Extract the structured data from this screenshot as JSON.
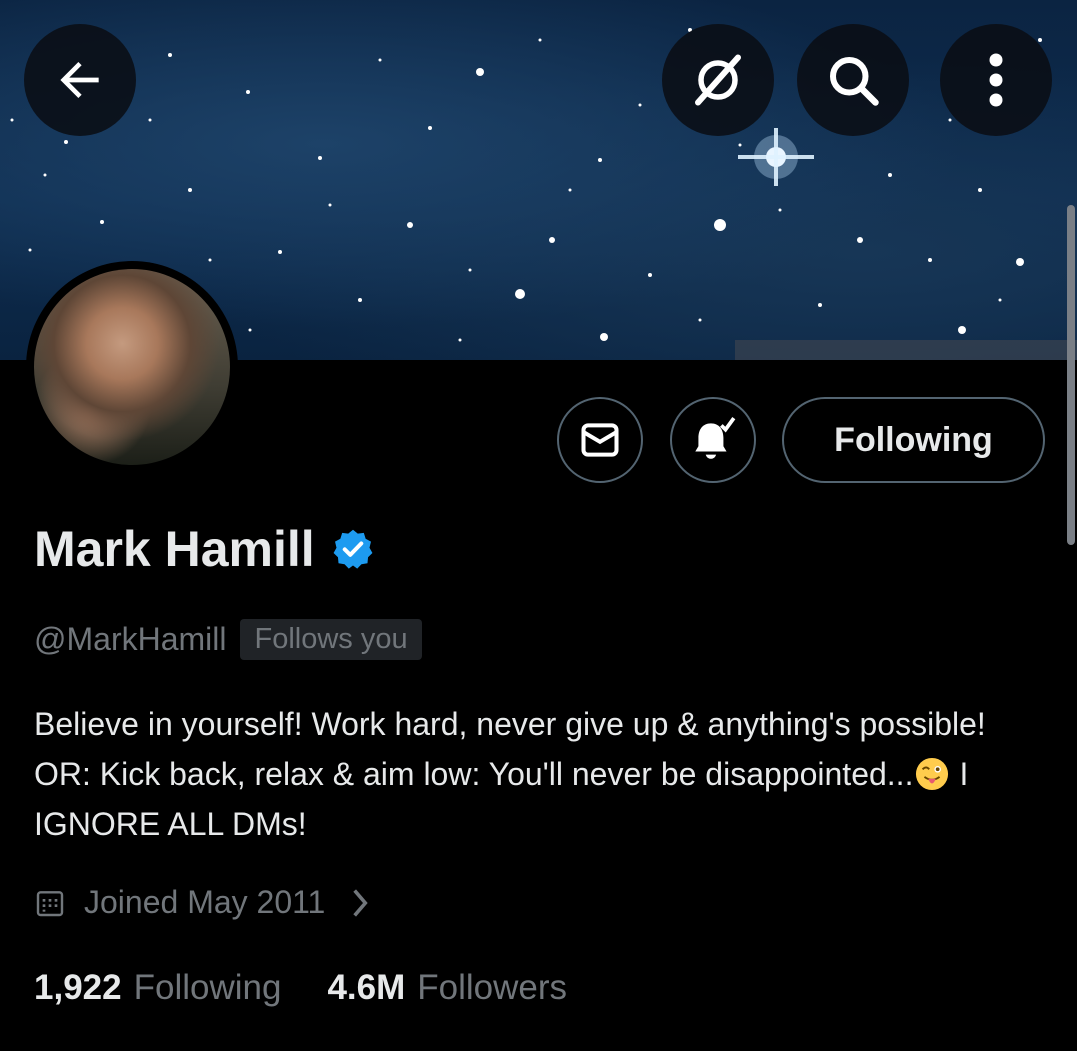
{
  "header": {
    "back_icon": "arrow-left-icon",
    "grok_icon": "grok-slash-icon",
    "search_icon": "search-icon",
    "more_icon": "more-vertical-icon"
  },
  "profile": {
    "display_name": "Mark Hamill",
    "verified": true,
    "handle": "@MarkHamill",
    "follows_you_label": "Follows you",
    "bio_part1": "Believe in yourself! Work hard, never give up & anything's possible! OR: Kick back, relax & aim low: You'll never be disappointed...",
    "bio_emoji": "winking-face-with-tongue",
    "bio_part2": "I IGNORE ALL DMs!",
    "joined": "Joined May 2011"
  },
  "actions": {
    "message_icon": "envelope-icon",
    "notify_icon": "bell-check-icon",
    "follow_label": "Following"
  },
  "stats": {
    "following_count": "1,922",
    "following_label": "Following",
    "followers_count": "4.6M",
    "followers_label": "Followers"
  },
  "colors": {
    "background": "#000000",
    "verified_blue": "#1d9bf0",
    "muted_text": "#71767b",
    "border": "#536471"
  }
}
